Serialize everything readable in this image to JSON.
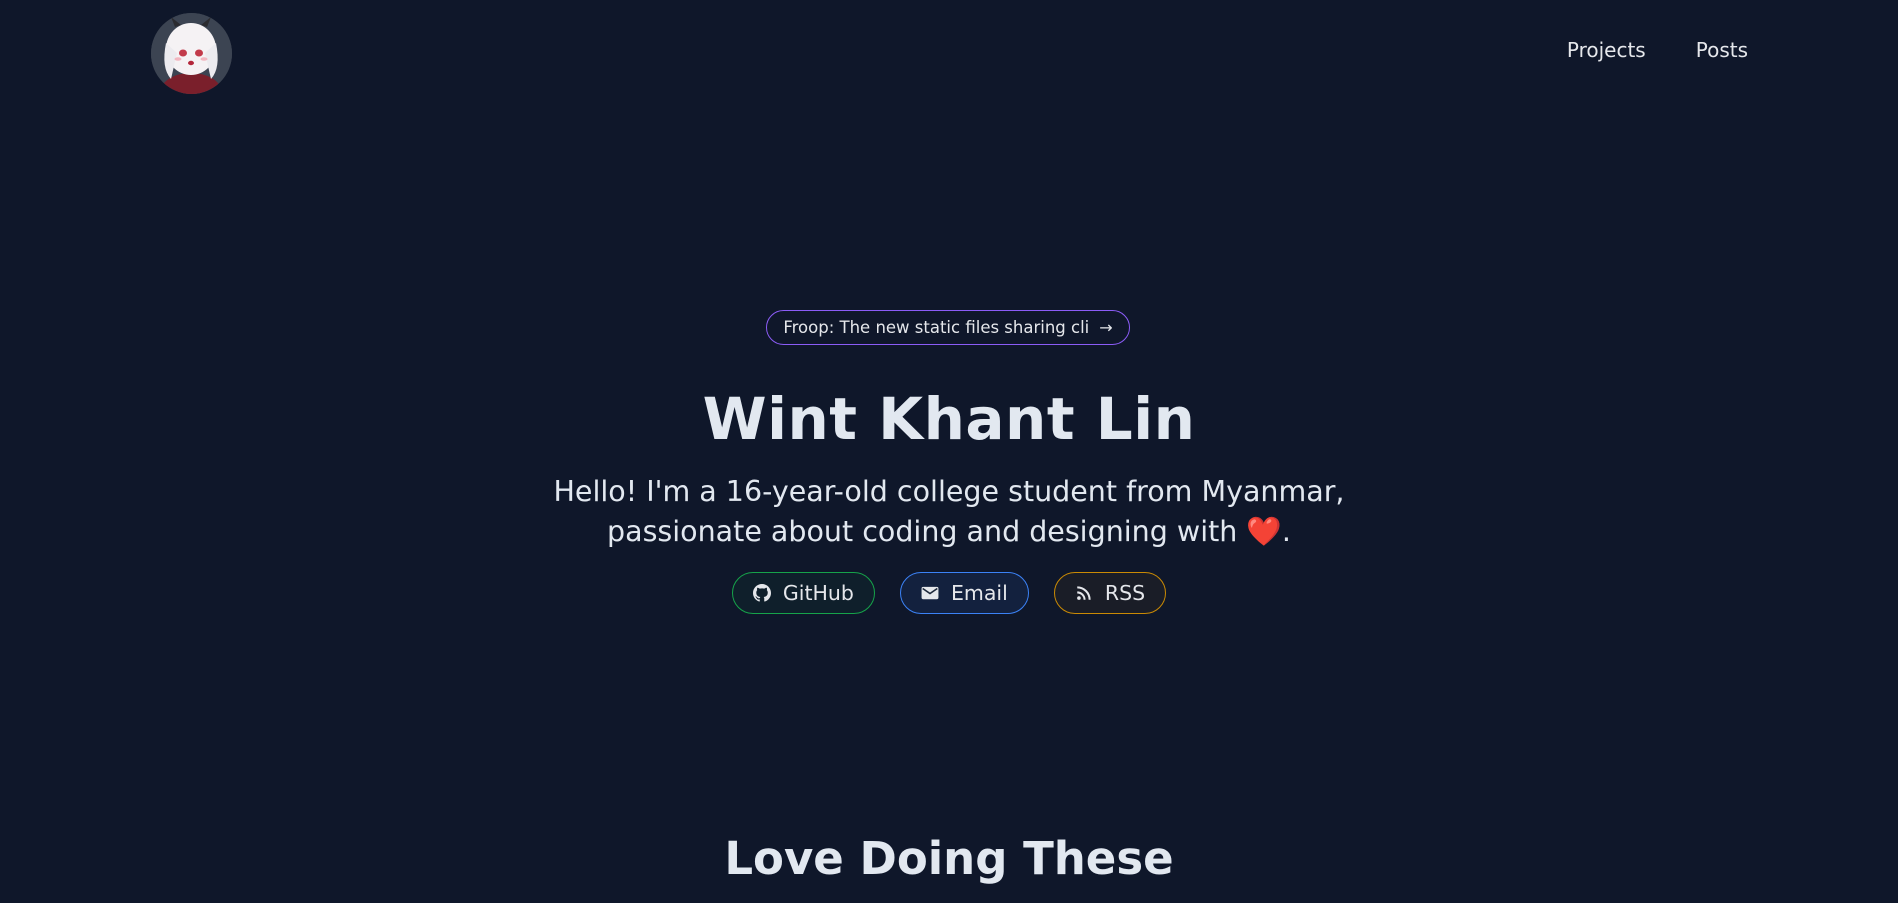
{
  "header": {
    "avatar_alt": "avatar",
    "nav": [
      {
        "label": "Projects"
      },
      {
        "label": "Posts"
      }
    ]
  },
  "hero": {
    "announcement": "Froop: The new static files sharing cli",
    "name": "Wint Khant Lin",
    "bio_line1": "Hello! I'm a 16-year-old college student from Myanmar,",
    "bio_line2_prefix": "passionate about coding and designing with ",
    "bio_line2_heart": "❤️",
    "bio_line2_suffix": "."
  },
  "links": [
    {
      "label": "GitHub",
      "icon": "github-icon",
      "color": "#16a34a"
    },
    {
      "label": "Email",
      "icon": "mail-icon",
      "color": "#3b82f6"
    },
    {
      "label": "RSS",
      "icon": "rss-icon",
      "color": "#ca8a04"
    }
  ],
  "sections": {
    "love_title": "Love Doing These"
  },
  "colors": {
    "background": "#0f172a",
    "text": "#e2e8f0",
    "announcement_border": "#8b5cf6"
  }
}
